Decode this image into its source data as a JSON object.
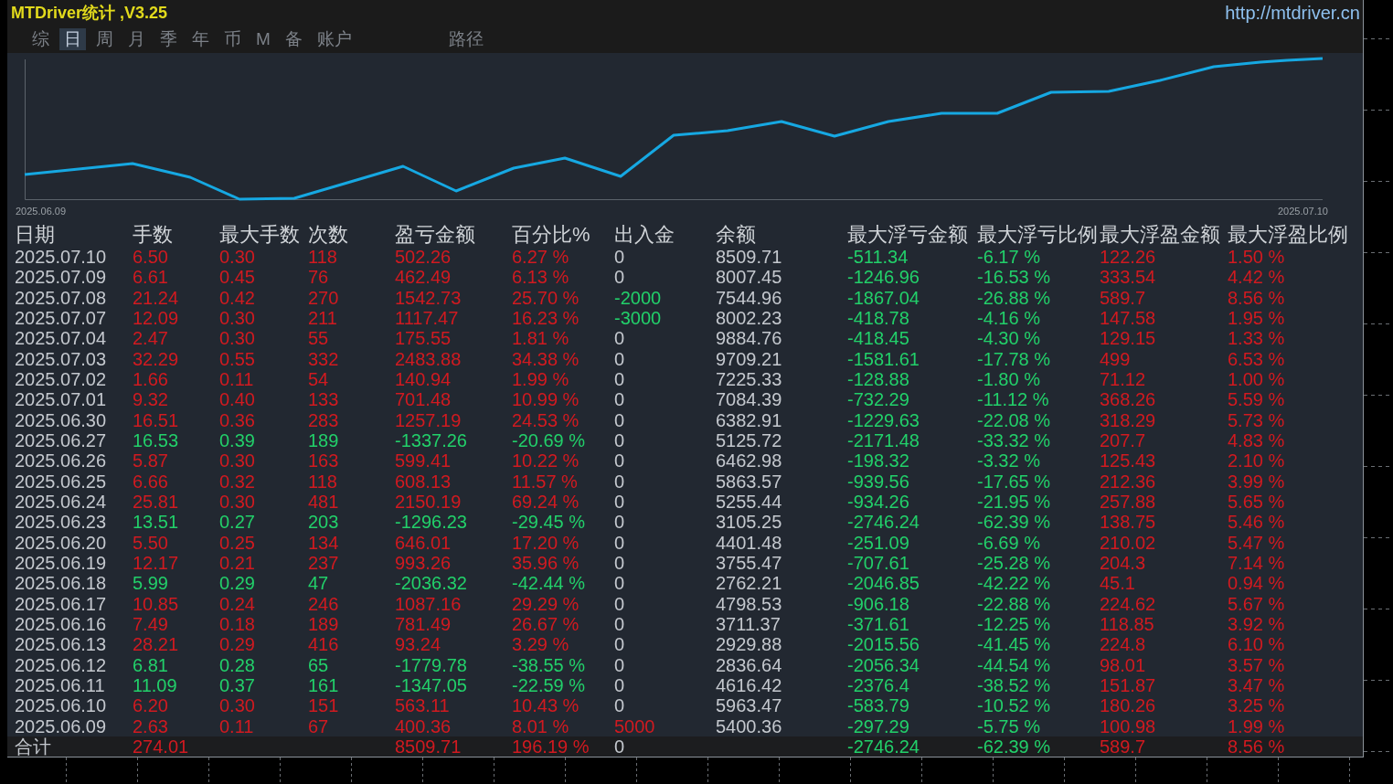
{
  "window": {
    "title": "MTDriver统计 ,V3.25",
    "link": "http://mtdriver.cn"
  },
  "tabs": [
    {
      "label": "综",
      "selected": false
    },
    {
      "label": "日",
      "selected": true
    },
    {
      "label": "周",
      "selected": false
    },
    {
      "label": "月",
      "selected": false
    },
    {
      "label": "季",
      "selected": false
    },
    {
      "label": "年",
      "selected": false
    },
    {
      "label": "币",
      "selected": false
    },
    {
      "label": "M",
      "selected": false
    },
    {
      "label": "备",
      "selected": false
    },
    {
      "label": "账户",
      "selected": false
    }
  ],
  "path_button": {
    "label": "路径"
  },
  "chart": {
    "x_start_label": "2025.06.09",
    "x_end_label": "2025.07.10"
  },
  "table": {
    "columns": [
      "日期",
      "手数",
      "最大手数",
      "次数",
      "盈亏金额",
      "百分比%",
      "出入金",
      "余额",
      "最大浮亏金额",
      "最大浮亏比例",
      "最大浮盈金额",
      "最大浮盈比例"
    ],
    "rows": [
      {
        "kind": "profit",
        "cells": [
          "2025.07.10",
          "6.50",
          "0.30",
          "118",
          "502.26",
          "6.27 %",
          {
            "text": "0",
            "kind": "none"
          },
          "8509.71",
          "-511.34",
          "-6.17 %",
          "122.26",
          "1.50 %"
        ]
      },
      {
        "kind": "profit",
        "cells": [
          "2025.07.09",
          "6.61",
          "0.45",
          "76",
          "462.49",
          "6.13 %",
          {
            "text": "0",
            "kind": "none"
          },
          "8007.45",
          "-1246.96",
          "-16.53 %",
          "333.54",
          "4.42 %"
        ]
      },
      {
        "kind": "profit",
        "cells": [
          "2025.07.08",
          "21.24",
          "0.42",
          "270",
          "1542.73",
          "25.70 %",
          {
            "text": "-2000",
            "kind": "withdrawal"
          },
          "7544.96",
          "-1867.04",
          "-26.88 %",
          "589.7",
          "8.56 %"
        ]
      },
      {
        "kind": "profit",
        "cells": [
          "2025.07.07",
          "12.09",
          "0.30",
          "211",
          "1117.47",
          "16.23 %",
          {
            "text": "-3000",
            "kind": "withdrawal"
          },
          "8002.23",
          "-418.78",
          "-4.16 %",
          "147.58",
          "1.95 %"
        ]
      },
      {
        "kind": "profit",
        "cells": [
          "2025.07.04",
          "2.47",
          "0.30",
          "55",
          "175.55",
          "1.81 %",
          {
            "text": "0",
            "kind": "none"
          },
          "9884.76",
          "-418.45",
          "-4.30 %",
          "129.15",
          "1.33 %"
        ]
      },
      {
        "kind": "profit",
        "cells": [
          "2025.07.03",
          "32.29",
          "0.55",
          "332",
          "2483.88",
          "34.38 %",
          {
            "text": "0",
            "kind": "none"
          },
          "9709.21",
          "-1581.61",
          "-17.78 %",
          "499",
          "6.53 %"
        ]
      },
      {
        "kind": "profit",
        "cells": [
          "2025.07.02",
          "1.66",
          "0.11",
          "54",
          "140.94",
          "1.99 %",
          {
            "text": "0",
            "kind": "none"
          },
          "7225.33",
          "-128.88",
          "-1.80 %",
          "71.12",
          "1.00 %"
        ]
      },
      {
        "kind": "profit",
        "cells": [
          "2025.07.01",
          "9.32",
          "0.40",
          "133",
          "701.48",
          "10.99 %",
          {
            "text": "0",
            "kind": "none"
          },
          "7084.39",
          "-732.29",
          "-11.12 %",
          "368.26",
          "5.59 %"
        ]
      },
      {
        "kind": "profit",
        "cells": [
          "2025.06.30",
          "16.51",
          "0.36",
          "283",
          "1257.19",
          "24.53 %",
          {
            "text": "0",
            "kind": "none"
          },
          "6382.91",
          "-1229.63",
          "-22.08 %",
          "318.29",
          "5.73 %"
        ]
      },
      {
        "kind": "loss",
        "cells": [
          "2025.06.27",
          "16.53",
          "0.39",
          "189",
          "-1337.26",
          "-20.69 %",
          {
            "text": "0",
            "kind": "none"
          },
          "5125.72",
          "-2171.48",
          "-33.32 %",
          "207.7",
          "4.83 %"
        ]
      },
      {
        "kind": "profit",
        "cells": [
          "2025.06.26",
          "5.87",
          "0.30",
          "163",
          "599.41",
          "10.22 %",
          {
            "text": "0",
            "kind": "none"
          },
          "6462.98",
          "-198.32",
          "-3.32 %",
          "125.43",
          "2.10 %"
        ]
      },
      {
        "kind": "profit",
        "cells": [
          "2025.06.25",
          "6.66",
          "0.32",
          "118",
          "608.13",
          "11.57 %",
          {
            "text": "0",
            "kind": "none"
          },
          "5863.57",
          "-939.56",
          "-17.65 %",
          "212.36",
          "3.99 %"
        ]
      },
      {
        "kind": "profit",
        "cells": [
          "2025.06.24",
          "25.81",
          "0.30",
          "481",
          "2150.19",
          "69.24 %",
          {
            "text": "0",
            "kind": "none"
          },
          "5255.44",
          "-934.26",
          "-21.95 %",
          "257.88",
          "5.65 %"
        ]
      },
      {
        "kind": "loss",
        "cells": [
          "2025.06.23",
          "13.51",
          "0.27",
          "203",
          "-1296.23",
          "-29.45 %",
          {
            "text": "0",
            "kind": "none"
          },
          "3105.25",
          "-2746.24",
          "-62.39 %",
          "138.75",
          "5.46 %"
        ]
      },
      {
        "kind": "profit",
        "cells": [
          "2025.06.20",
          "5.50",
          "0.25",
          "134",
          "646.01",
          "17.20 %",
          {
            "text": "0",
            "kind": "none"
          },
          "4401.48",
          "-251.09",
          "-6.69 %",
          "210.02",
          "5.47 %"
        ]
      },
      {
        "kind": "profit",
        "cells": [
          "2025.06.19",
          "12.17",
          "0.21",
          "237",
          "993.26",
          "35.96 %",
          {
            "text": "0",
            "kind": "none"
          },
          "3755.47",
          "-707.61",
          "-25.28 %",
          "204.3",
          "7.14 %"
        ]
      },
      {
        "kind": "loss",
        "cells": [
          "2025.06.18",
          "5.99",
          "0.29",
          "47",
          "-2036.32",
          "-42.44 %",
          {
            "text": "0",
            "kind": "none"
          },
          "2762.21",
          "-2046.85",
          "-42.22 %",
          "45.1",
          "0.94 %"
        ]
      },
      {
        "kind": "profit",
        "cells": [
          "2025.06.17",
          "10.85",
          "0.24",
          "246",
          "1087.16",
          "29.29 %",
          {
            "text": "0",
            "kind": "none"
          },
          "4798.53",
          "-906.18",
          "-22.88 %",
          "224.62",
          "5.67 %"
        ]
      },
      {
        "kind": "profit",
        "cells": [
          "2025.06.16",
          "7.49",
          "0.18",
          "189",
          "781.49",
          "26.67 %",
          {
            "text": "0",
            "kind": "none"
          },
          "3711.37",
          "-371.61",
          "-12.25 %",
          "118.85",
          "3.92 %"
        ]
      },
      {
        "kind": "profit",
        "cells": [
          "2025.06.13",
          "28.21",
          "0.29",
          "416",
          "93.24",
          "3.29 %",
          {
            "text": "0",
            "kind": "none"
          },
          "2929.88",
          "-2015.56",
          "-41.45 %",
          "224.8",
          "6.10 %"
        ]
      },
      {
        "kind": "loss",
        "cells": [
          "2025.06.12",
          "6.81",
          "0.28",
          "65",
          "-1779.78",
          "-38.55 %",
          {
            "text": "0",
            "kind": "none"
          },
          "2836.64",
          "-2056.34",
          "-44.54 %",
          "98.01",
          "3.57 %"
        ]
      },
      {
        "kind": "loss",
        "cells": [
          "2025.06.11",
          "11.09",
          "0.37",
          "161",
          "-1347.05",
          "-22.59 %",
          {
            "text": "0",
            "kind": "none"
          },
          "4616.42",
          "-2376.4",
          "-38.52 %",
          "151.87",
          "3.47 %"
        ]
      },
      {
        "kind": "profit",
        "cells": [
          "2025.06.10",
          "6.20",
          "0.30",
          "151",
          "563.11",
          "10.43 %",
          {
            "text": "0",
            "kind": "none"
          },
          "5963.47",
          "-583.79",
          "-10.52 %",
          "180.26",
          "3.25 %"
        ]
      },
      {
        "kind": "profit",
        "cells": [
          "2025.06.09",
          "2.63",
          "0.11",
          "67",
          "400.36",
          "8.01 %",
          {
            "text": "5000",
            "kind": "deposit"
          },
          "5400.36",
          "-297.29",
          "-5.75 %",
          "100.98",
          "1.99 %"
        ]
      }
    ],
    "total": {
      "kind": "profit",
      "cells": [
        "合计",
        "274.01",
        null,
        null,
        "8509.71",
        "196.19 %",
        {
          "text": "0",
          "kind": "none"
        },
        null,
        "-2746.24",
        "-62.39 %",
        "589.7",
        "8.56 %"
      ]
    }
  }
}
